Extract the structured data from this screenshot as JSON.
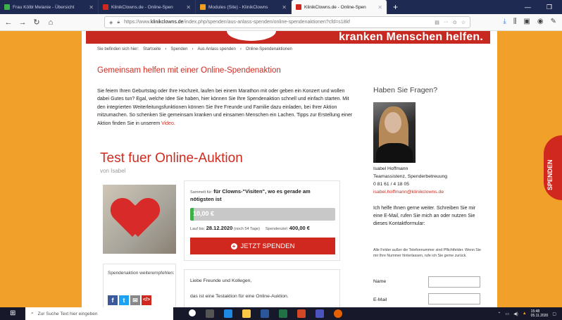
{
  "browser": {
    "tabs": [
      {
        "label": "Frau Kölbl Melanie - Übersicht",
        "color": "#3eb049"
      },
      {
        "label": "KlinikClowns.de - Online-Spen",
        "color": "#d0271e"
      },
      {
        "label": "Modules (Site) - KlinikClowns",
        "color": "#f0a020"
      },
      {
        "label": "KlinikClowns.de - Online-Spen",
        "color": "#d0271e"
      }
    ],
    "new_tab": "+",
    "url_prefix": "https://www.",
    "url_domain": "klinikclowns.de",
    "url_path": "/index.php/spenden/aus-anlass-spenden/online-spendenaktionen?cfd=s18kf",
    "url_more": "···"
  },
  "banner": {
    "slogan": "kranken Menschen helfen."
  },
  "breadcrumb": [
    "Sie befinden sich hier:",
    "Startseite",
    "›",
    "Spenden",
    "›",
    "Aus Anlass spenden",
    "›",
    "Online-Spendenaktionen"
  ],
  "heading": "Gemeinsam helfen mit einer Online-Spendenaktion",
  "intro": {
    "text": "Sie feiern Ihren Geburtstag oder Ihre Hochzeit, laufen bei einem Marathon mit oder geben ein Konzert und wollen dabei Gutes tun? Egal, welche Idee Sie haben, hier können Sie Ihre Spendenaktion schnell und einfach starten. Mit den integrierten Weiterleitungsfunktionen können Sie Ihre Freunde und Familie dazu einladen, bei Ihrer Aktion mitzumachen. So schenken Sie gemeinsam kranken und einsamen Menschen ein Lachen. Tipps zur Erstellung einer Aktion finden Sie in unserem ",
    "link": "Video",
    "end": "."
  },
  "auction": {
    "title": "Test fuer Online-Auktion",
    "by": "von Isabel",
    "collect_prefix": "Sammelt für:",
    "collect_for": "für Clowns-\"Visiten\", wo es gerade am nötigsten ist",
    "amount": "10,00 €",
    "progress_fraction": 0.025,
    "runtime_prefix": "Lauf bis:",
    "runtime_date": "28.12.2020",
    "runtime_note": "(noch 54 Tage)",
    "goal_prefix": "Spendenziel:",
    "goal": "400,00 €",
    "donate_button": "JETZT SPENDEN",
    "share_label": "Spendenaktion weiterempfehlen:",
    "message_line1": "Liebe Freunde und Kollegen,",
    "message_line2": "das ist eine Testaktion für eine Online-Auktion."
  },
  "sidebar": {
    "title": "Haben Sie Fragen?",
    "name": "Isabel Hoffmann",
    "role": "Teamassistenz, Spenderbetreuung",
    "phone": "0 81 61 / 4 18 05",
    "email": "isabel.hoffmann@klinikclowns.de",
    "help": "Ich helfe Ihnen gerne weiter. Schreiben Sie mir eine E-Mail, rufen Sie mich an oder nutzen Sie dieses Kontaktformular:",
    "required_note": "Alle Felder außer die Telefonnummer sind Pflichtfelder. Wenn Sie mir Ihre Nummer hinterlassen, rufe ich Sie gerne zurück.",
    "label_name": "Name",
    "label_email": "E-Mail"
  },
  "side_tab": "SPENDEN",
  "taskbar": {
    "search_placeholder": "Zur Suche Text hier eingeben",
    "time": "15:48",
    "date": "05.11.2020"
  }
}
